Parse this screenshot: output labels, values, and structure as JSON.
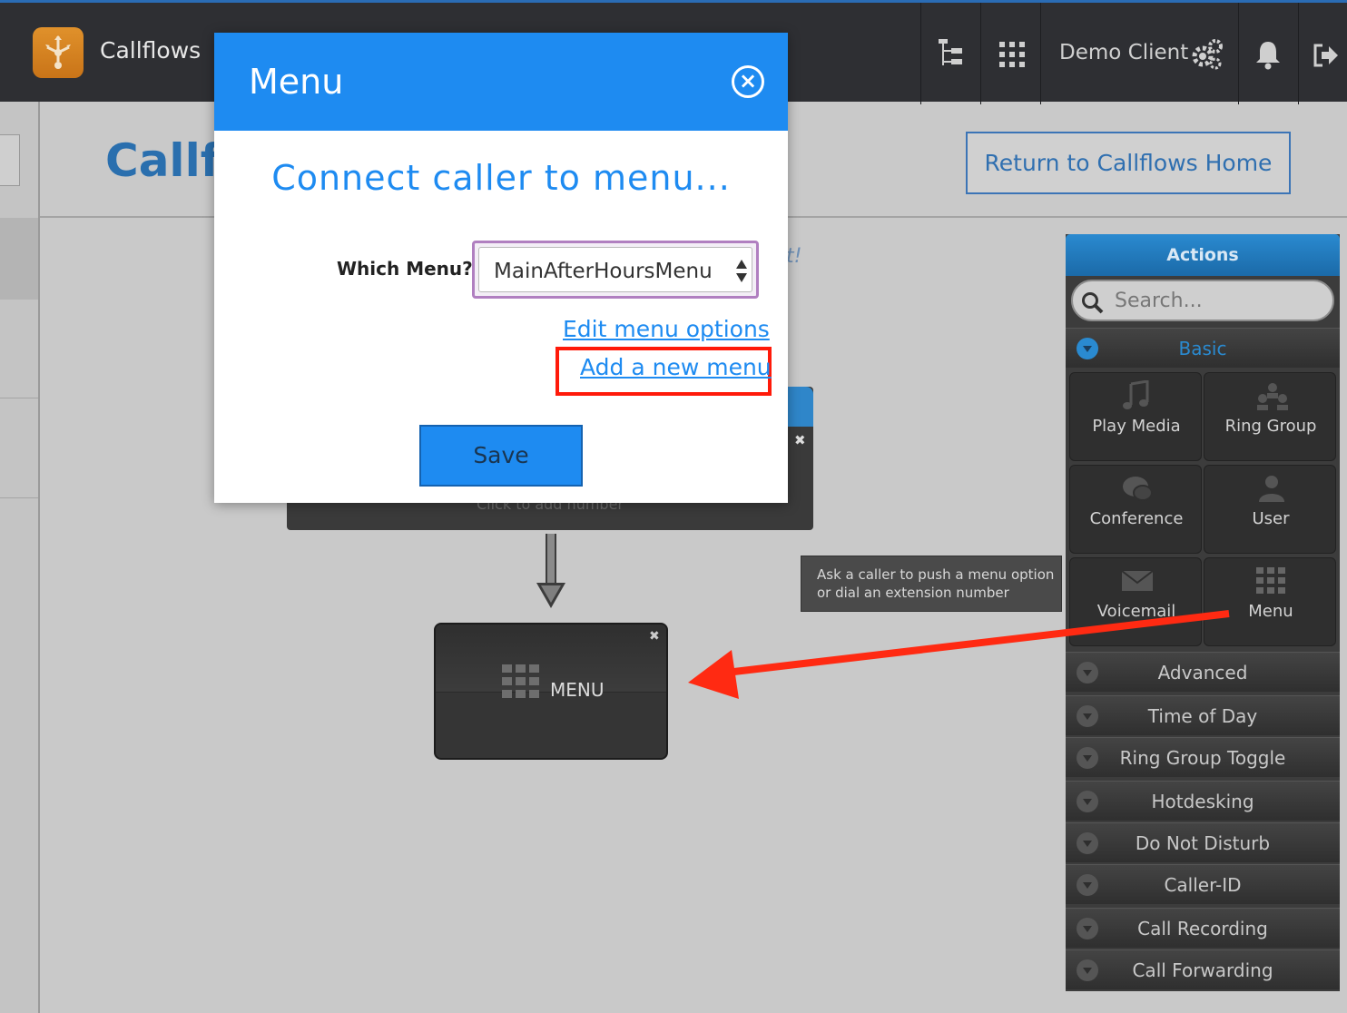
{
  "app": {
    "title": "Callflows",
    "account": "Demo Client"
  },
  "header": {
    "page_title": "Callflows",
    "return_button": "Return to Callflows Home"
  },
  "canvas": {
    "hint_text": "t!",
    "start_node": {
      "subtitle": "Click to add number"
    },
    "menu_node": {
      "label": "MENU"
    }
  },
  "tooltip": {
    "line1": "Ask a caller to push a menu option",
    "line2": "or dial an extension number"
  },
  "actions": {
    "title": "Actions",
    "search_placeholder": "Search...",
    "basic_label": "Basic",
    "basic_items": [
      "Play Media",
      "Ring Group",
      "Conference",
      "User",
      "Voicemail",
      "Menu"
    ],
    "categories": [
      "Advanced",
      "Time of Day",
      "Ring Group Toggle",
      "Hotdesking",
      "Do Not Disturb",
      "Caller-ID",
      "Call Recording",
      "Call Forwarding"
    ]
  },
  "dialog": {
    "title": "Menu",
    "subtitle": "Connect caller to menu...",
    "which_label": "Which Menu?",
    "selected_menu": "MainAfterHoursMenu",
    "edit_link": "Edit menu options",
    "add_link": "Add a new menu",
    "save_label": "Save"
  },
  "colors": {
    "accent": "#1e8bf1",
    "highlight": "#ff1a0a",
    "topbar": "#2e2f33"
  },
  "icons": [
    "callflow-logo-icon",
    "tree-icon",
    "apps-grid-icon",
    "gear-icon",
    "bell-icon",
    "logout-icon",
    "search-icon",
    "close-icon",
    "music-icon",
    "group-icon",
    "chat-icon",
    "user-icon",
    "envelope-icon",
    "grid-icon"
  ]
}
